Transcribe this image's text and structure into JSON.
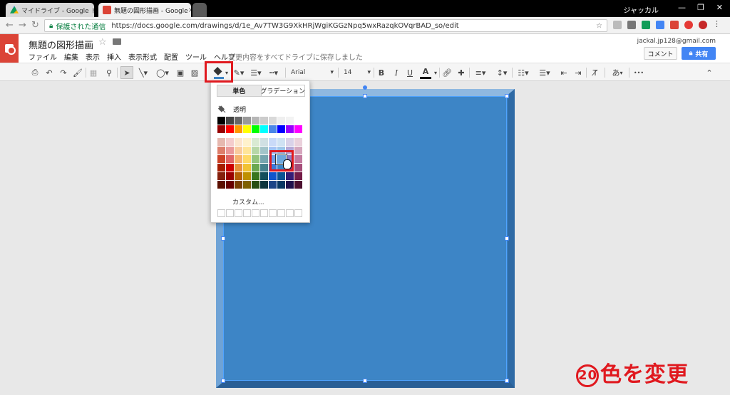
{
  "browser": {
    "tabs": [
      {
        "title": "マイドライブ - Google ドライ",
        "close": "×"
      },
      {
        "title": "無題の図形描画 - Google",
        "close": "×"
      }
    ],
    "user": "ジャッカル",
    "win_controls": {
      "min": "—",
      "max": "❐",
      "close": "✕"
    },
    "secure_label": "保護された通信",
    "url": "https://docs.google.com/drawings/d/1e_Av7TW3G9XkHRjWgiKGGzNpq5wxRazqkOVqrBAD_so/edit"
  },
  "app": {
    "title": "無題の図形描画",
    "menus": [
      "ファイル",
      "編集",
      "表示",
      "挿入",
      "表示形式",
      "配置",
      "ツール",
      "ヘルプ"
    ],
    "saved_status": "変更内容をすべてドライブに保存しました",
    "email": "jackal.jp128@gmail.com",
    "comment_label": "コメント",
    "share_label": "共有"
  },
  "toolbar": {
    "font": "Arial",
    "font_size": "14",
    "bold": "B",
    "italic": "I",
    "underline": "U",
    "text_color": "A",
    "more": "•••",
    "input_method": "あ",
    "collapse": "⌃"
  },
  "palette": {
    "tab_solid": "単色",
    "tab_gradient": "グラデーション",
    "transparent_label": "透明",
    "custom_label": "カスタム...",
    "rows": [
      [
        "#000000",
        "#434343",
        "#666666",
        "#999999",
        "#b7b7b7",
        "#cccccc",
        "#d9d9d9",
        "#efefef",
        "#f3f3f3",
        "#ffffff"
      ],
      [
        "#980000",
        "#ff0000",
        "#ff9900",
        "#ffff00",
        "#00ff00",
        "#00ffff",
        "#4a86e8",
        "#0000ff",
        "#9900ff",
        "#ff00ff"
      ],
      [
        "#e6b8af",
        "#f4cccc",
        "#fce5cd",
        "#fff2cc",
        "#d9ead3",
        "#d0e0e3",
        "#c9daf8",
        "#cfe2f3",
        "#d9d2e9",
        "#ead1dc"
      ],
      [
        "#dd7e6b",
        "#ea9999",
        "#f9cb9c",
        "#ffe599",
        "#b6d7a8",
        "#a2c4c9",
        "#a4c2f4",
        "#9fc5e8",
        "#b4a7d6",
        "#d5a6bd"
      ],
      [
        "#cc4125",
        "#e06666",
        "#f6b26b",
        "#ffd966",
        "#93c47d",
        "#76a5af",
        "#6d9eeb",
        "#6fa8dc",
        "#8e7cc3",
        "#c27ba0"
      ],
      [
        "#a61c00",
        "#cc0000",
        "#e69138",
        "#f1c232",
        "#6aa84f",
        "#45818e",
        "#3c78d8",
        "#3d85c6",
        "#674ea7",
        "#a64d79"
      ],
      [
        "#85200c",
        "#990000",
        "#b45f06",
        "#bf9000",
        "#38761d",
        "#134f5c",
        "#1155cc",
        "#0b5394",
        "#351c75",
        "#741b47"
      ],
      [
        "#5b0f00",
        "#660000",
        "#783f04",
        "#7f6000",
        "#274e13",
        "#0c343d",
        "#1c4587",
        "#073763",
        "#20124d",
        "#4c1130"
      ]
    ],
    "selected_color": "#6fa8dc"
  },
  "canvas": {
    "shape_fill": "#3d85c6"
  },
  "annotation": {
    "number": "20",
    "text": "色を変更"
  }
}
